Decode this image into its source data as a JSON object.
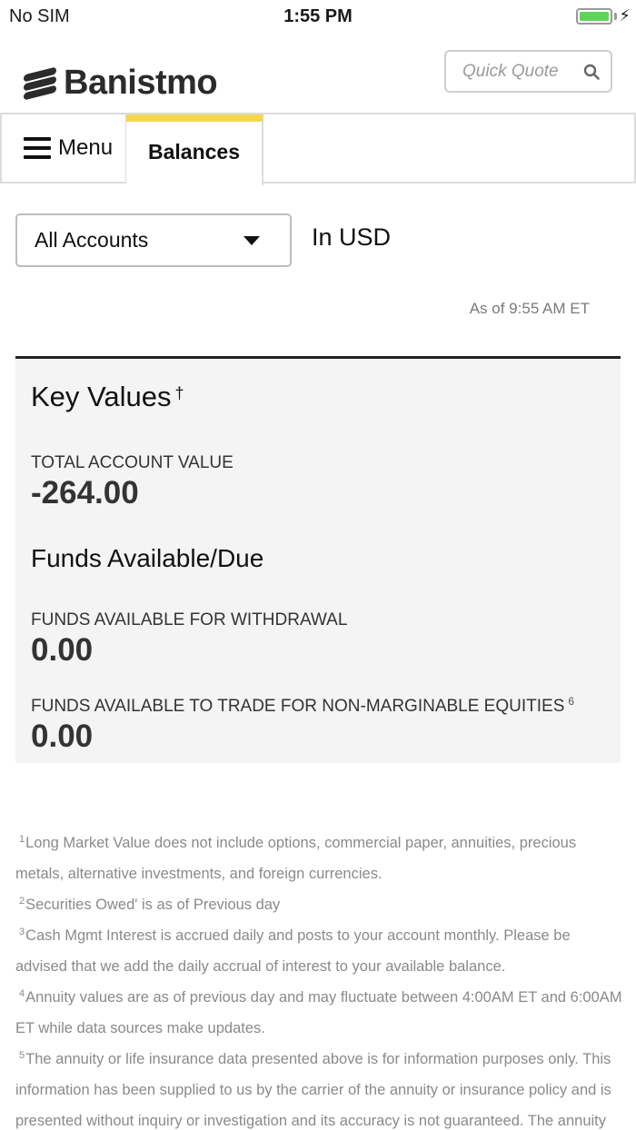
{
  "status_bar": {
    "carrier": "No SIM",
    "time": "1:55 PM"
  },
  "header": {
    "brand": "Banistmo",
    "quick_quote_placeholder": "Quick Quote"
  },
  "tabs": {
    "menu_label": "Menu",
    "active_tab_label": "Balances"
  },
  "account_selector": {
    "selected": "All Accounts",
    "currency_label": "In USD",
    "as_of": "As of  9:55 AM ET"
  },
  "key_values": {
    "title": "Key Values",
    "title_marker": "†",
    "total_account_value_label": "TOTAL ACCOUNT VALUE",
    "total_account_value": "-264.00",
    "funds_section_title": "Funds Available/Due",
    "withdrawal_label": "FUNDS AVAILABLE FOR WITHDRAWAL",
    "withdrawal_value": "0.00",
    "trade_label": "FUNDS AVAILABLE TO TRADE FOR NON-MARGINABLE EQUITIES",
    "trade_marker": "6",
    "trade_value": "0.00"
  },
  "footnotes": [
    {
      "num": "1",
      "text": "Long Market Value does not include options, commercial paper, annuities, precious metals, alternative investments, and foreign currencies."
    },
    {
      "num": "2",
      "text": "Securities Owed' is as of Previous day"
    },
    {
      "num": "3",
      "text": "Cash Mgmt Interest is accrued daily and posts to your account monthly. Please be advised that we add the daily accrual of interest to your available balance."
    },
    {
      "num": "4",
      "text": "Annuity values are as of previous day and may fluctuate between 4:00AM ET and 6:00AM ET while data sources make updates."
    },
    {
      "num": "5",
      "text": "The annuity or life insurance data presented above is for information purposes only. This information has been supplied to us by the carrier of the annuity or insurance policy and is presented without inquiry or investigation and its accuracy is not guaranteed. The annuity"
    }
  ],
  "colors": {
    "tab_accent": "#f5d64f",
    "panel_background": "#f4f4f4",
    "battery": "#5fd35a"
  },
  "icons": [
    "battery-icon",
    "charging-bolt-icon",
    "banistmo-logo-icon",
    "search-icon",
    "hamburger-icon",
    "chevron-down-icon"
  ]
}
